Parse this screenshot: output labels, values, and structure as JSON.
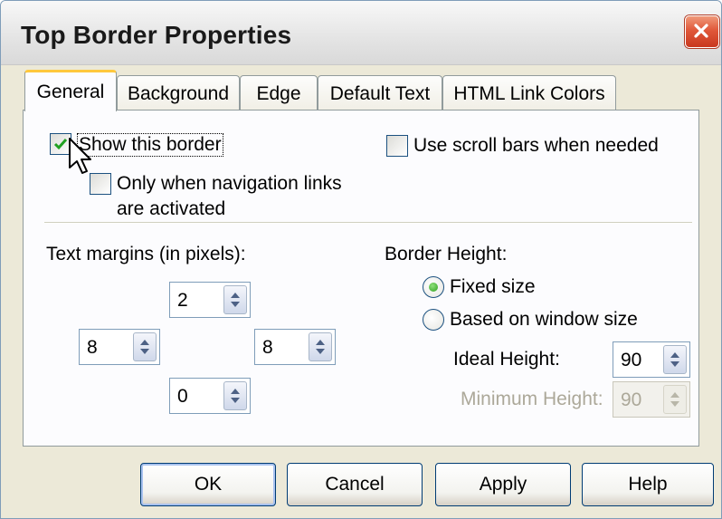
{
  "window": {
    "title": "Top Border Properties",
    "close_icon": "close-x-icon"
  },
  "tabs": [
    {
      "label": "General",
      "active": true
    },
    {
      "label": "Background",
      "active": false
    },
    {
      "label": "Edge",
      "active": false
    },
    {
      "label": "Default Text",
      "active": false
    },
    {
      "label": "HTML Link Colors",
      "active": false
    }
  ],
  "general": {
    "show_border": {
      "label": "Show this border",
      "checked": true
    },
    "only_nav_links": {
      "label_line1": "Only when navigation links",
      "label_line2": "are activated",
      "checked": false
    },
    "scroll_bars": {
      "label": "Use scroll bars when needed",
      "checked": false
    },
    "text_margins": {
      "label": "Text margins (in pixels):",
      "top": "2",
      "left": "8",
      "right": "8",
      "bottom": "0"
    },
    "border_height": {
      "label": "Border Height:",
      "fixed_size": {
        "label": "Fixed size",
        "selected": true
      },
      "based_on_window": {
        "label": "Based on window size",
        "selected": false
      },
      "ideal_height": {
        "label": "Ideal Height:",
        "value": "90"
      },
      "minimum_height": {
        "label": "Minimum Height:",
        "value": "90",
        "disabled": true
      }
    }
  },
  "buttons": {
    "ok": "OK",
    "cancel": "Cancel",
    "apply": "Apply",
    "help": "Help"
  },
  "colors": {
    "tab_highlight": "#ffc83c",
    "close_button": "#e0583a",
    "check_mark": "#21a121",
    "radio_dot": "#30a020"
  }
}
